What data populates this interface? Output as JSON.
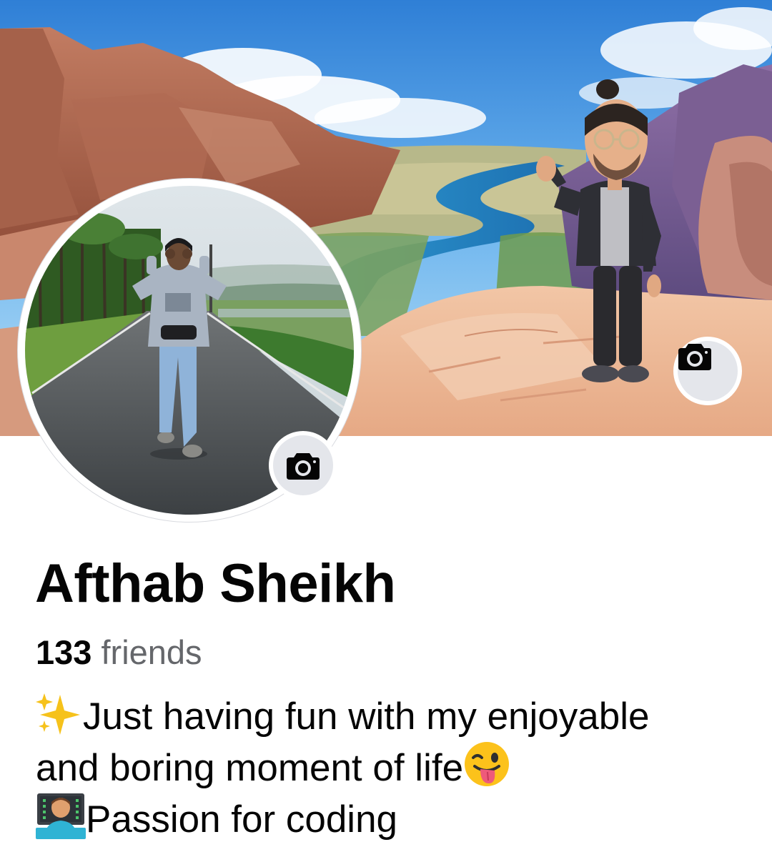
{
  "cover": {
    "description_icon": "cover-photo"
  },
  "profile": {
    "name": "Afthab Sheikh",
    "friends_count": "133",
    "friends_label": " friends",
    "avatar_icon": "profile-photo"
  },
  "bio": {
    "line1": "Just having fun with my enjoyable",
    "line2": "and boring moment of life",
    "line3": "Passion for coding",
    "emoji1": "sparkles-emoji",
    "emoji2": "winking-face-with-tongue-emoji",
    "emoji3": "technologist-emoji"
  },
  "icons": {
    "cover_camera": "camera-icon",
    "profile_camera": "camera-icon"
  },
  "colors": {
    "text_primary": "#050505",
    "text_secondary": "#65676b",
    "button_bg": "#e4e6eb"
  }
}
